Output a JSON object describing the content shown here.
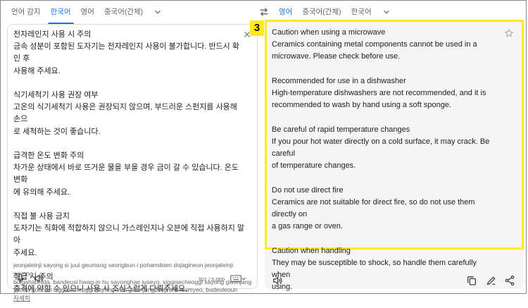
{
  "source_langs": {
    "tabs": [
      "언어 감지",
      "한국어",
      "영어",
      "중국어(간체)"
    ],
    "active_index": 1
  },
  "target_langs": {
    "tabs": [
      "영어",
      "중국어(간체)",
      "한국어"
    ],
    "active_index": 0
  },
  "source": {
    "blocks": [
      [
        "전자레인지 사용 시 주의",
        "금속 성분이 포함된 도자기는 전자레인지 사용이 불가합니다. 반드시 확인 후",
        "사용해 주세요."
      ],
      [
        "식기세척기 사용 권장 여부",
        "고온의 식기세척기 사용은 권장되지 않으며, 부드러운 스펀지를 사용해 손으",
        "로 세척하는 것이 좋습니다."
      ],
      [
        "급격한 온도 변화 주의",
        "차가운 상태에서 바로 뜨거운 물을 부을 경우 금이 갈 수 있습니다. 온도 변화",
        "에 유의해 주세요."
      ],
      [
        "직접 불 사용 금지",
        "도자기는 직화에 적합하지 않으니 가스레인지나 오븐에 직접 사용하지 말아",
        "주세요."
      ],
      [
        "취급 시 주의",
        "충격에 약할 수 있으니 사용 시 조심스럽게 다뤄주세요."
      ]
    ],
    "romanization": [
      "jeonjaleinji sayong si juui geumsog seongbun-i pohamdoen dojagineun jeonjaleinji sayong-i",
      "bulgahabnida. bandeusi hwag-in hu sayonghae juseyo. siggisecheoggi sayong gwonjang",
      "yeobu goon-ui siggisecheoggi sayong-eun gwonjangdoeji anh-eumyeo, budeuleoun"
    ],
    "more_label": "자세히",
    "char_count": "301 / 5,000"
  },
  "target": {
    "blocks": [
      [
        "Caution when using a microwave",
        "Ceramics containing metal components cannot be used in a",
        "microwave. Please check before use."
      ],
      [
        "Recommended for use in a dishwasher",
        "High-temperature dishwashers are not recommended, and it is",
        "recommended to wash by hand using a soft sponge."
      ],
      [
        "Be careful of rapid temperature changes",
        "If you pour hot water directly on a cold surface, it may crack. Be careful",
        "of temperature changes."
      ],
      [
        "Do not use direct fire",
        "Ceramics are not suitable for direct fire, so do not use them directly on",
        "a gas range or oven."
      ],
      [
        "Caution when handling",
        "They may be susceptible to shock, so handle them carefully when",
        "using."
      ]
    ]
  },
  "annotation": {
    "badge": "3",
    "color": "#ffeb1a"
  },
  "accent_color": "#1a73e8",
  "icons": [
    "chevron-down-icon",
    "swap-languages-icon",
    "close-icon",
    "microphone-icon",
    "speaker-icon",
    "keyboard-icon",
    "star-icon",
    "copy-icon",
    "feedback-icon",
    "share-icon"
  ]
}
